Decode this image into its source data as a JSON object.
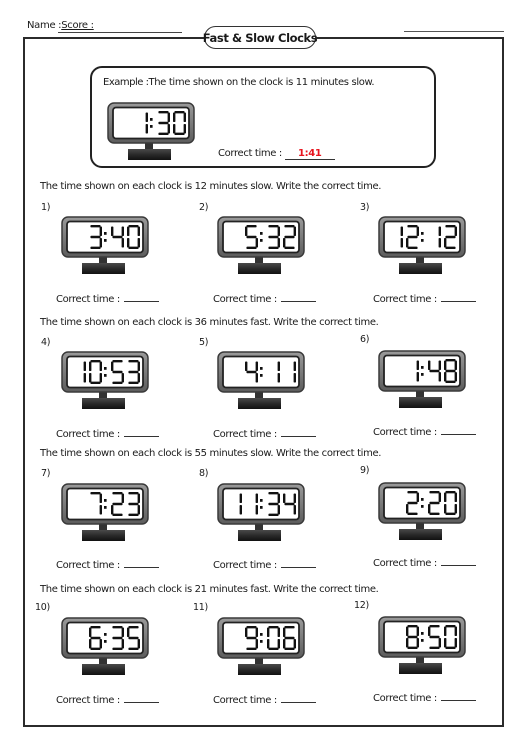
{
  "header": {
    "name_label": "Name :",
    "score_label": "Score :",
    "title": "Fast & Slow Clocks"
  },
  "example": {
    "prefix": "Example :",
    "text": "The time shown on the clock is 11 minutes slow.",
    "clock_time": "1:30",
    "correct_time_label": "Correct time :",
    "answer": "1:41",
    "answer_color": "#e8141e"
  },
  "sections": [
    {
      "instruction": "The time shown on each clock is 12 minutes slow. Write the correct time.",
      "problems": [
        {
          "number": "1)",
          "time": "3:40",
          "label": "Correct time :"
        },
        {
          "number": "2)",
          "time": "5:32",
          "label": "Correct time :"
        },
        {
          "number": "3)",
          "time": "12:12",
          "label": "Correct time :"
        }
      ]
    },
    {
      "instruction": "The time shown on each clock is 36 minutes fast. Write the correct time.",
      "problems": [
        {
          "number": "4)",
          "time": "10:53",
          "label": "Correct time :"
        },
        {
          "number": "5)",
          "time": "4:11",
          "label": "Correct time :"
        },
        {
          "number": "6)",
          "time": "1:48",
          "label": "Correct time :"
        }
      ]
    },
    {
      "instruction": "The time shown on each clock is 55 minutes slow. Write the correct time.",
      "problems": [
        {
          "number": "7)",
          "time": "7:23",
          "label": "Correct time :"
        },
        {
          "number": "8)",
          "time": "11:34",
          "label": "Correct time :"
        },
        {
          "number": "9)",
          "time": "2:20",
          "label": "Correct time :"
        }
      ]
    },
    {
      "instruction": "The time shown on each clock is 21 minutes fast. Write the correct time.",
      "problems": [
        {
          "number": "10)",
          "time": "6:35",
          "label": "Correct time :"
        },
        {
          "number": "11)",
          "time": "9:06",
          "label": "Correct time :"
        },
        {
          "number": "12)",
          "time": "8:50",
          "label": "Correct time :"
        }
      ]
    }
  ]
}
